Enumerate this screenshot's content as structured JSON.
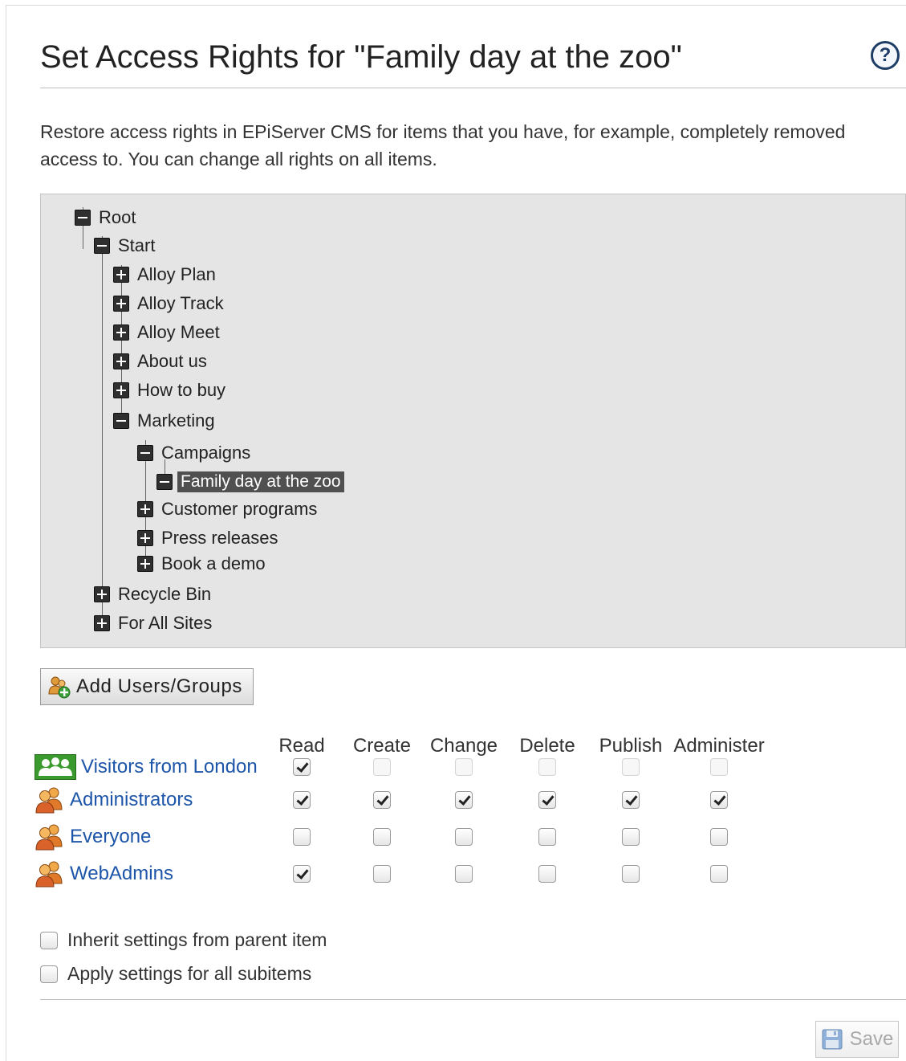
{
  "header": {
    "title": "Set Access Rights for \"Family day at the zoo\"",
    "help_icon_label": "?"
  },
  "description": "Restore access rights in EPiServer CMS for items that you have, for example, completely removed access to. You can change all rights on all items.",
  "tree": {
    "nodes": [
      {
        "label": "Root",
        "expanded": true
      },
      {
        "label": "Start",
        "expanded": true
      },
      {
        "label": "Alloy Plan",
        "expanded": false
      },
      {
        "label": "Alloy Track",
        "expanded": false
      },
      {
        "label": "Alloy Meet",
        "expanded": false
      },
      {
        "label": "About us",
        "expanded": false
      },
      {
        "label": "How to buy",
        "expanded": false
      },
      {
        "label": "Marketing",
        "expanded": true
      },
      {
        "label": "Campaigns",
        "expanded": true
      },
      {
        "label": "Family day at the zoo",
        "expanded": true,
        "selected": true
      },
      {
        "label": "Customer programs",
        "expanded": false
      },
      {
        "label": "Press releases",
        "expanded": false
      },
      {
        "label": "Book a demo",
        "expanded": false
      },
      {
        "label": "Recycle Bin",
        "expanded": false
      },
      {
        "label": "For All Sites",
        "expanded": false
      }
    ]
  },
  "add_button": {
    "label": "Add Users/Groups",
    "icon": "add-users-groups-icon"
  },
  "permissions": {
    "columns": [
      "Read",
      "Create",
      "Change",
      "Delete",
      "Publish",
      "Administer"
    ],
    "rows": [
      {
        "name": "Visitors from London",
        "icon": "visitor-group-icon",
        "checked": [
          true,
          false,
          false,
          false,
          false,
          false
        ],
        "disabled": true
      },
      {
        "name": "Administrators",
        "icon": "user-group-icon",
        "checked": [
          true,
          true,
          true,
          true,
          true,
          true
        ],
        "disabled": false
      },
      {
        "name": "Everyone",
        "icon": "user-group-icon",
        "checked": [
          false,
          false,
          false,
          false,
          false,
          false
        ],
        "disabled": false
      },
      {
        "name": "WebAdmins",
        "icon": "user-group-icon",
        "checked": [
          true,
          false,
          false,
          false,
          false,
          false
        ],
        "disabled": false
      }
    ]
  },
  "options": {
    "inherit_label": "Inherit settings from parent item",
    "inherit_checked": false,
    "apply_label": "Apply settings for all subitems",
    "apply_checked": false
  },
  "save_button": {
    "label": "Save",
    "icon": "floppy-disk-icon",
    "enabled": false
  },
  "colors": {
    "link": "#1d55a8",
    "tree_background": "#e5e5e5",
    "selected_node_background": "#505050",
    "visitor_group_icon": "#3a9a2e",
    "user_group_icon": "#d9822b"
  }
}
